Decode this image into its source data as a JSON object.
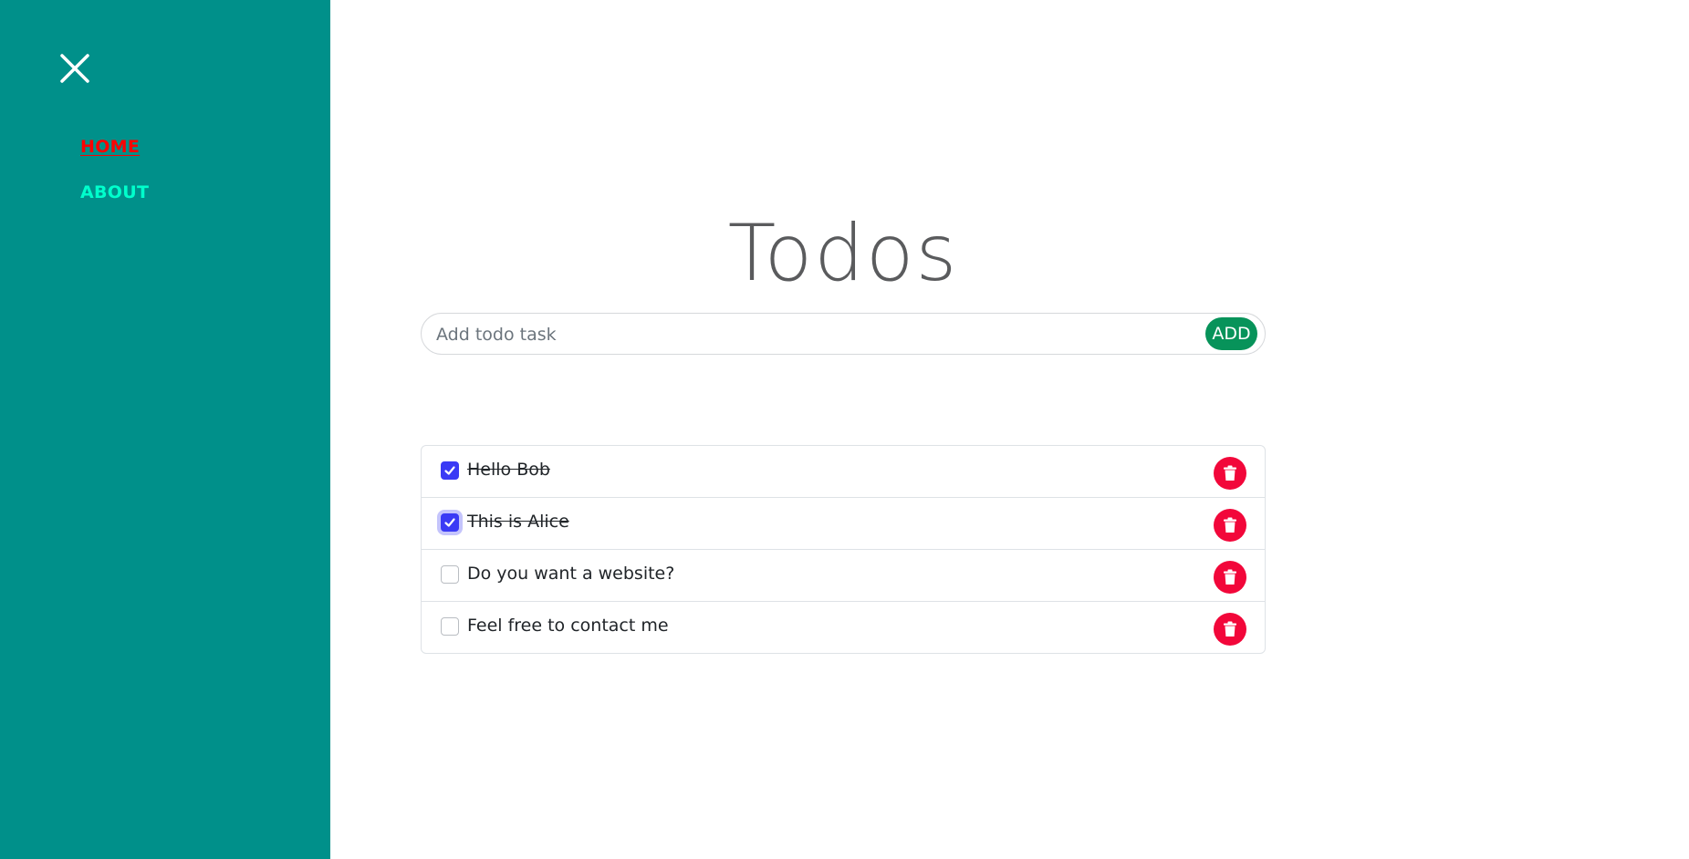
{
  "sidebar": {
    "close_icon": "close-icon",
    "nav": [
      {
        "label": "HOME",
        "active": true
      },
      {
        "label": "ABOUT",
        "active": false
      }
    ]
  },
  "main": {
    "title": "Todos",
    "add_form": {
      "placeholder": "Add todo task",
      "value": "",
      "button_label": "ADD"
    },
    "todos": [
      {
        "text": "Hello Bob",
        "done": true
      },
      {
        "text": "This is Alice",
        "done": true
      },
      {
        "text": "Do you want a website?",
        "done": false
      },
      {
        "text": "Feel free to contact me",
        "done": false
      }
    ],
    "delete_icon": "trash-icon"
  },
  "colors": {
    "sidebar_bg": "#00908a",
    "nav_active": "#ff0000",
    "nav_inactive": "#00ffcc",
    "add_button": "#07935a",
    "checkbox_checked": "#3b3bf5",
    "delete_button": "#f2073a",
    "title_text": "#5a5b5d"
  }
}
